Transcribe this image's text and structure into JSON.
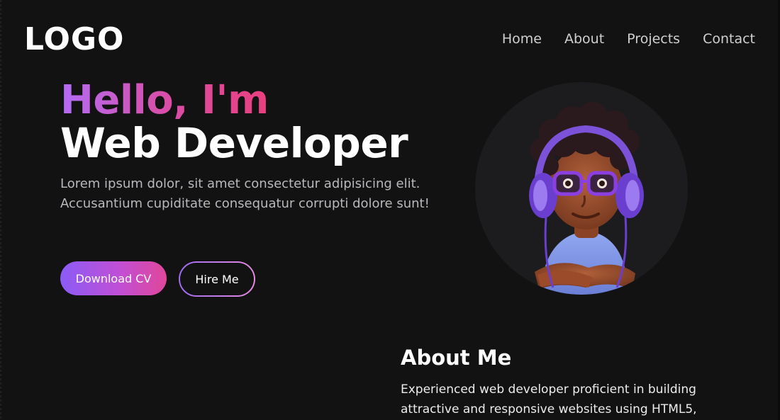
{
  "brand": {
    "logo_text": "LOGO"
  },
  "nav": {
    "items": [
      "Home",
      "About",
      "Projects",
      "Contact"
    ]
  },
  "hero": {
    "greeting": "Hello, I'm",
    "role": "Web Developer",
    "description": "Lorem ipsum dolor, sit amet consectetur adipisicing elit. Accusantium cupiditate consequatur corrupti dolore sunt!",
    "primary_button": "Download CV",
    "secondary_button": "Hire Me",
    "portrait_icon": "avatar-illustration"
  },
  "about": {
    "heading": "About Me",
    "text": "Experienced web developer proficient in building attractive and responsive websites using HTML5,"
  },
  "colors": {
    "background": "#121213",
    "gradient_start": "#b36cf5",
    "gradient_end": "#ea3f7e",
    "button_gradient_start": "#8b5cf6",
    "button_gradient_end": "#e0479a",
    "muted_text": "#b8b8bd"
  }
}
